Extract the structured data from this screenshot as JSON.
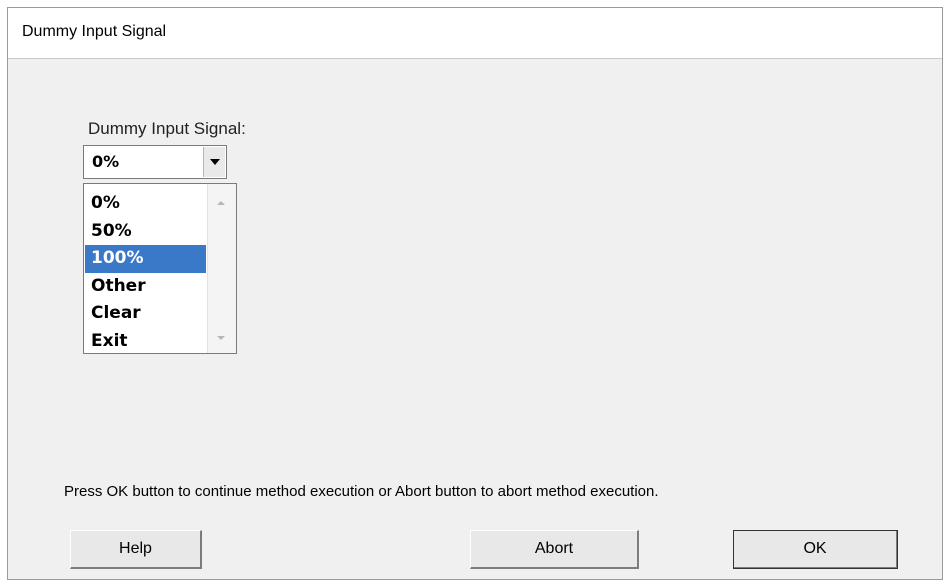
{
  "window": {
    "title": "Dummy Input Signal"
  },
  "field": {
    "label": "Dummy Input Signal:",
    "selected_value": "0%"
  },
  "dropdown": {
    "options": [
      "0%",
      "50%",
      "100%",
      "Other",
      "Clear",
      "Exit"
    ],
    "highlighted": "100%"
  },
  "message": "Press OK button to continue method execution or Abort button to abort method execution.",
  "buttons": {
    "help": "Help",
    "abort": "Abort",
    "ok": "OK"
  },
  "colors": {
    "highlight": "#3a78c8",
    "dialog_bg": "#f0f0f0"
  }
}
